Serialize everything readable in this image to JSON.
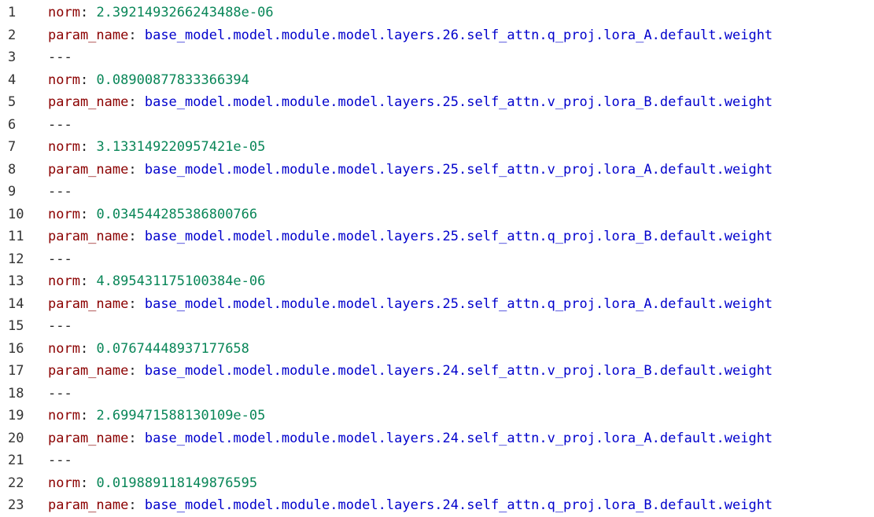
{
  "editor": {
    "lines": [
      {
        "no": "1",
        "kind": "kv",
        "key": "norm",
        "value": "2.3921493266243488e-06",
        "vtype": "num"
      },
      {
        "no": "2",
        "kind": "kv",
        "key": "param_name",
        "value": "base_model.model.module.model.layers.26.self_attn.q_proj.lora_A.default.weight",
        "vtype": "str"
      },
      {
        "no": "3",
        "kind": "sep",
        "text": "---"
      },
      {
        "no": "4",
        "kind": "kv",
        "key": "norm",
        "value": "0.08900877833366394",
        "vtype": "num"
      },
      {
        "no": "5",
        "kind": "kv",
        "key": "param_name",
        "value": "base_model.model.module.model.layers.25.self_attn.v_proj.lora_B.default.weight",
        "vtype": "str"
      },
      {
        "no": "6",
        "kind": "sep",
        "text": "---"
      },
      {
        "no": "7",
        "kind": "kv",
        "key": "norm",
        "value": "3.133149220957421e-05",
        "vtype": "num"
      },
      {
        "no": "8",
        "kind": "kv",
        "key": "param_name",
        "value": "base_model.model.module.model.layers.25.self_attn.v_proj.lora_A.default.weight",
        "vtype": "str"
      },
      {
        "no": "9",
        "kind": "sep",
        "text": "---"
      },
      {
        "no": "10",
        "kind": "kv",
        "key": "norm",
        "value": "0.034544285386800766",
        "vtype": "num"
      },
      {
        "no": "11",
        "kind": "kv",
        "key": "param_name",
        "value": "base_model.model.module.model.layers.25.self_attn.q_proj.lora_B.default.weight",
        "vtype": "str"
      },
      {
        "no": "12",
        "kind": "sep",
        "text": "---"
      },
      {
        "no": "13",
        "kind": "kv",
        "key": "norm",
        "value": "4.895431175100384e-06",
        "vtype": "num"
      },
      {
        "no": "14",
        "kind": "kv",
        "key": "param_name",
        "value": "base_model.model.module.model.layers.25.self_attn.q_proj.lora_A.default.weight",
        "vtype": "str"
      },
      {
        "no": "15",
        "kind": "sep",
        "text": "---"
      },
      {
        "no": "16",
        "kind": "kv",
        "key": "norm",
        "value": "0.07674448937177658",
        "vtype": "num"
      },
      {
        "no": "17",
        "kind": "kv",
        "key": "param_name",
        "value": "base_model.model.module.model.layers.24.self_attn.v_proj.lora_B.default.weight",
        "vtype": "str"
      },
      {
        "no": "18",
        "kind": "sep",
        "text": "---"
      },
      {
        "no": "19",
        "kind": "kv",
        "key": "norm",
        "value": "2.699471588130109e-05",
        "vtype": "num"
      },
      {
        "no": "20",
        "kind": "kv",
        "key": "param_name",
        "value": "base_model.model.module.model.layers.24.self_attn.v_proj.lora_A.default.weight",
        "vtype": "str"
      },
      {
        "no": "21",
        "kind": "sep",
        "text": "---"
      },
      {
        "no": "22",
        "kind": "kv",
        "key": "norm",
        "value": "0.019889118149876595",
        "vtype": "num"
      },
      {
        "no": "23",
        "kind": "kv",
        "key": "param_name",
        "value": "base_model.model.module.model.layers.24.self_attn.q_proj.lora_B.default.weight",
        "vtype": "str"
      }
    ],
    "colors": {
      "key": "#8b0000",
      "number": "#098658",
      "string": "#0000cc",
      "line_number": "#333333"
    }
  }
}
